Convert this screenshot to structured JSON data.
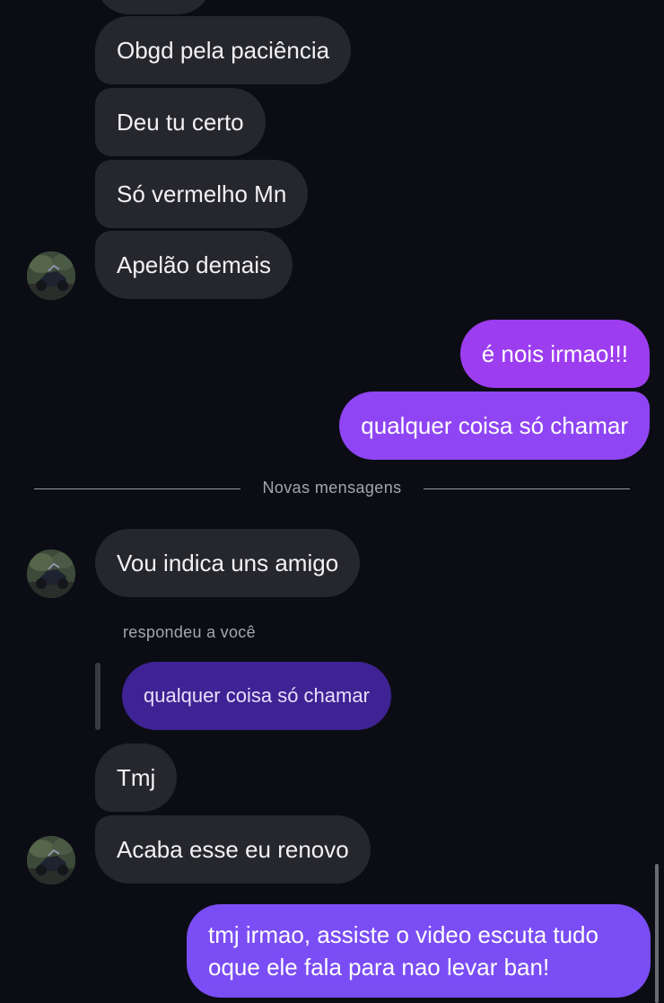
{
  "messages_before": [
    {
      "text": "Obgd pela paciência"
    },
    {
      "text": "Deu tu certo"
    },
    {
      "text": "Só vermelho Mn"
    },
    {
      "text": "Apelão demais"
    }
  ],
  "sent_before": [
    {
      "text": "é nois irmao!!!"
    },
    {
      "text": "qualquer coisa só chamar"
    }
  ],
  "divider": {
    "label": "Novas mensagens"
  },
  "message_after_divider": {
    "text": "Vou indica uns amigo"
  },
  "reply": {
    "label": "respondeu a você",
    "quoted_text": "qualquer coisa só chamar"
  },
  "messages_after": [
    {
      "text": "Tmj"
    },
    {
      "text": "Acaba esse eu renovo"
    }
  ],
  "sent_last": {
    "text": "tmj irmao, assiste o video escuta tudo oque ele fala para nao levar ban!"
  },
  "icons": {
    "contact_avatar": "contact-avatar-photo"
  },
  "colors": {
    "background": "#0c0d14",
    "incoming_bubble": "#26272d",
    "outgoing_bubble_1": "#9d3df0",
    "outgoing_bubble_2": "#8f45f3",
    "outgoing_bubble_3": "#7a4df5",
    "reply_quote": "#3f2294"
  }
}
